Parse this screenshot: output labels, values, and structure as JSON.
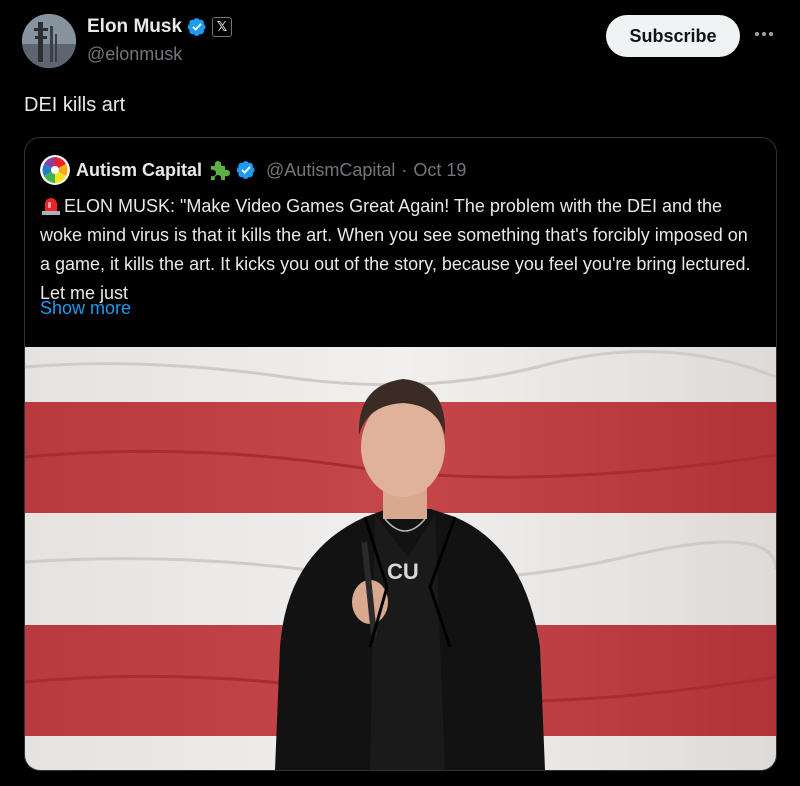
{
  "author": {
    "display_name": "Elon Musk",
    "handle": "@elonmusk",
    "verified_icon": "verified-badge-icon",
    "affiliation_icon": "x-logo-icon",
    "affiliation_glyph": "𝕏"
  },
  "actions": {
    "subscribe_label": "Subscribe",
    "more_icon": "more-options-icon"
  },
  "tweet": {
    "text": "DEI kills art"
  },
  "quoted": {
    "display_name": "Autism Capital",
    "handle": "@AutismCapital",
    "separator": "·",
    "date": "Oct 19",
    "text": "ELON MUSK: \"Make Video Games Great Again! The problem with the DEI and the woke mind virus is that it kills the art. When you see something that's forcibly imposed on a game, it kills the art. It kicks you out of the story, because you feel you're bring lectured. Let me just",
    "show_more": "Show more",
    "media_icon": "photo-speaker-on-stage"
  },
  "colors": {
    "background": "#000000",
    "text": "#e7e9ea",
    "secondary": "#71767b",
    "link": "#1d9bf0",
    "verified": "#1d9bf0",
    "border": "#2f3336"
  }
}
